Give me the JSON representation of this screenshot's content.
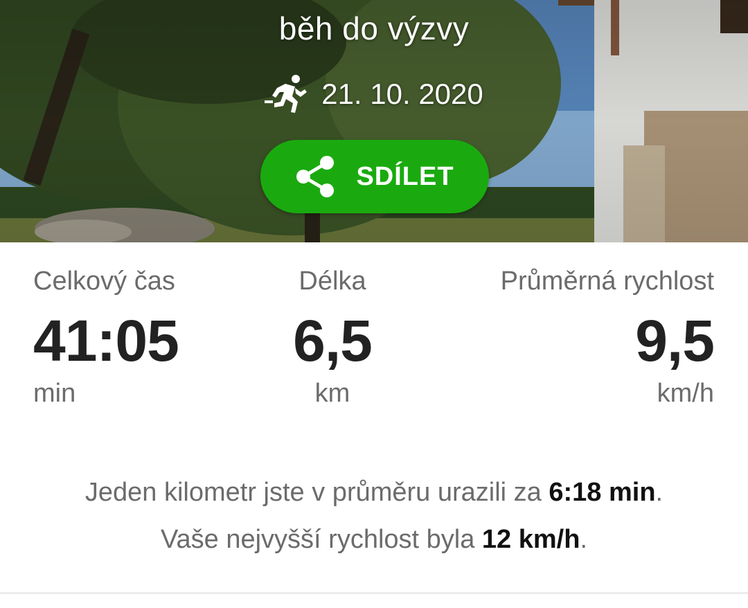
{
  "hero": {
    "title": "běh do výzvy",
    "date": "21. 10. 2020",
    "activity_icon": "running-person-icon",
    "share_label": "SDÍLET",
    "share_icon": "share-icon",
    "accent_color": "#1aaa0f"
  },
  "stats": {
    "time": {
      "label": "Celkový čas",
      "value": "41:05",
      "unit": "min"
    },
    "distance": {
      "label": "Délka",
      "value": "6,5",
      "unit": "km"
    },
    "speed": {
      "label": "Průměrná rychlost",
      "value": "9,5",
      "unit": "km/h"
    }
  },
  "summary": {
    "pace_prefix": "Jeden kilometr jste v průměru urazili za ",
    "pace_value": "6:18 min",
    "pace_suffix": ".",
    "max_prefix": "Vaše nejvyšší rychlost byla ",
    "max_value": "12 km/h",
    "max_suffix": "."
  }
}
